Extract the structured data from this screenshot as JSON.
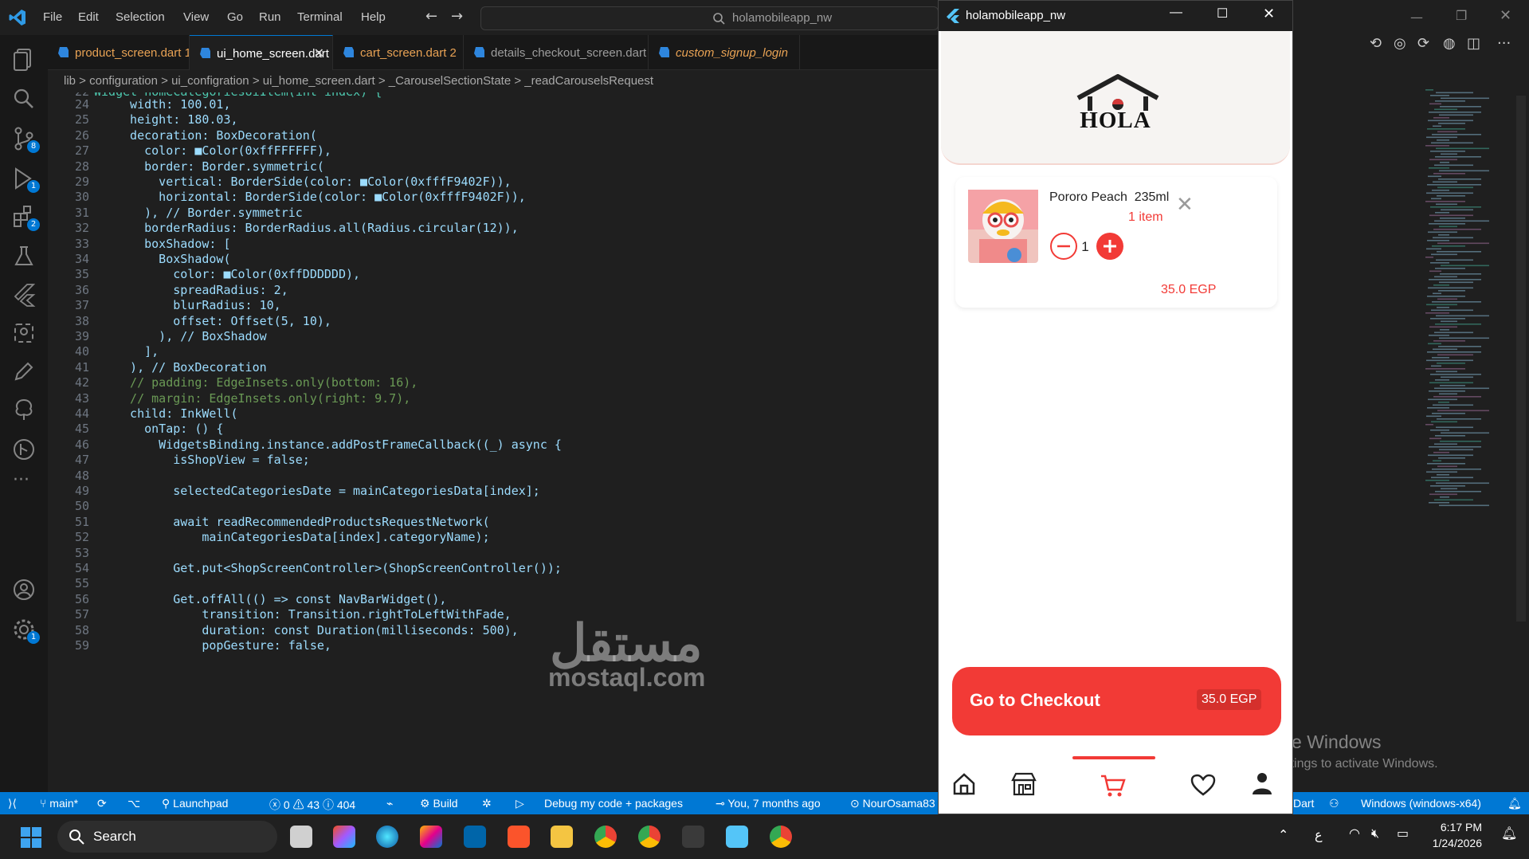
{
  "menu": [
    "File",
    "Edit",
    "Selection",
    "View",
    "Go",
    "Run",
    "Terminal",
    "Help"
  ],
  "search_text": "holamobileapp_nw",
  "tabs": [
    {
      "label": "product_screen.dart 1",
      "color": "#e8a254"
    },
    {
      "label": "ui_home_screen.dart",
      "color": "#ffffff"
    },
    {
      "label": "cart_screen.dart 2",
      "color": "#e8a254"
    },
    {
      "label": "details_checkout_screen.dart",
      "color": "#9d9d9d"
    },
    {
      "label": "custom_signup_login",
      "color": "#e8a254"
    }
  ],
  "breadcrumb": "lib > configuration > ui_configration > ui_home_screen.dart > _CarouselSectionState > _readCarouselsRequest",
  "activity_badges": {
    "source_control": "8",
    "debug": "1",
    "extensions": "2",
    "accounts": "1"
  },
  "code_lines": [
    {
      "n": "22",
      "t": "Widget homeCategoriesUiItem(int index) {"
    },
    {
      "n": "24",
      "t": "  width: 100.01,"
    },
    {
      "n": "25",
      "t": "  height: 180.03,"
    },
    {
      "n": "26",
      "t": "  decoration: BoxDecoration("
    },
    {
      "n": "27",
      "t": "    color: ■Color(0xffFFFFFF),"
    },
    {
      "n": "28",
      "t": "    border: Border.symmetric("
    },
    {
      "n": "29",
      "t": "      vertical: BorderSide(color: ■Color(0xfffF9402F)),"
    },
    {
      "n": "30",
      "t": "      horizontal: BorderSide(color: ■Color(0xfffF9402F)),"
    },
    {
      "n": "31",
      "t": "    ), // Border.symmetric"
    },
    {
      "n": "32",
      "t": "    borderRadius: BorderRadius.all(Radius.circular(12)),"
    },
    {
      "n": "33",
      "t": "    boxShadow: ["
    },
    {
      "n": "34",
      "t": "      BoxShadow("
    },
    {
      "n": "35",
      "t": "        color: ■Color(0xffDDDDDD),"
    },
    {
      "n": "36",
      "t": "        spreadRadius: 2,"
    },
    {
      "n": "37",
      "t": "        blurRadius: 10,"
    },
    {
      "n": "38",
      "t": "        offset: Offset(5, 10),"
    },
    {
      "n": "39",
      "t": "      ), // BoxShadow"
    },
    {
      "n": "40",
      "t": "    ],"
    },
    {
      "n": "41",
      "t": "  ), // BoxDecoration"
    },
    {
      "n": "42",
      "t": "  // padding: EdgeInsets.only(bottom: 16),"
    },
    {
      "n": "43",
      "t": "  // margin: EdgeInsets.only(right: 9.7),"
    },
    {
      "n": "44",
      "t": "  child: InkWell("
    },
    {
      "n": "45",
      "t": "    onTap: () {"
    },
    {
      "n": "46",
      "t": "      WidgetsBinding.instance.addPostFrameCallback((_) async {"
    },
    {
      "n": "47",
      "t": "        isShopView = false;"
    },
    {
      "n": "48",
      "t": ""
    },
    {
      "n": "49",
      "t": "        selectedCategoriesDate = mainCategoriesData[index];"
    },
    {
      "n": "50",
      "t": ""
    },
    {
      "n": "51",
      "t": "        await readRecommendedProductsRequestNetwork("
    },
    {
      "n": "52",
      "t": "            mainCategoriesData[index].categoryName);"
    },
    {
      "n": "53",
      "t": ""
    },
    {
      "n": "54",
      "t": "        Get.put<ShopScreenController>(ShopScreenController());"
    },
    {
      "n": "55",
      "t": ""
    },
    {
      "n": "56",
      "t": "        Get.offAll(() => const NavBarWidget(),"
    },
    {
      "n": "57",
      "t": "            transition: Transition.rightToLeftWithFade,"
    },
    {
      "n": "58",
      "t": "            duration: const Duration(milliseconds: 500),"
    },
    {
      "n": "59",
      "t": "            popGesture: false,"
    }
  ],
  "status": {
    "branch": "main*",
    "launchpad": "Launchpad",
    "errors": "0",
    "warnings": "43",
    "info": "404",
    "build": "Build",
    "debug": "Debug my code + packages",
    "blame": "You, 7 months ago",
    "user": "NourOsama83",
    "lang": "Dart",
    "platform": "Windows (windows-x64)"
  },
  "phone": {
    "title": "holamobileapp_nw",
    "logo_text": "HOLA",
    "item_name": "Pororo Peach  235ml",
    "item_count": "1 item",
    "quantity": "1",
    "price": "35.0 EGP",
    "checkout_label": "Go to Checkout",
    "checkout_price": "35.0 EGP"
  },
  "activate": {
    "line1": "Activate Windows",
    "line2": "Go to Settings to activate Windows."
  },
  "taskbar": {
    "search": "Search",
    "time": "6:17 PM",
    "date": "1/24/2026",
    "lang": "ع"
  },
  "watermark": {
    "ar": "مستقل",
    "en": "mostaql.com"
  }
}
